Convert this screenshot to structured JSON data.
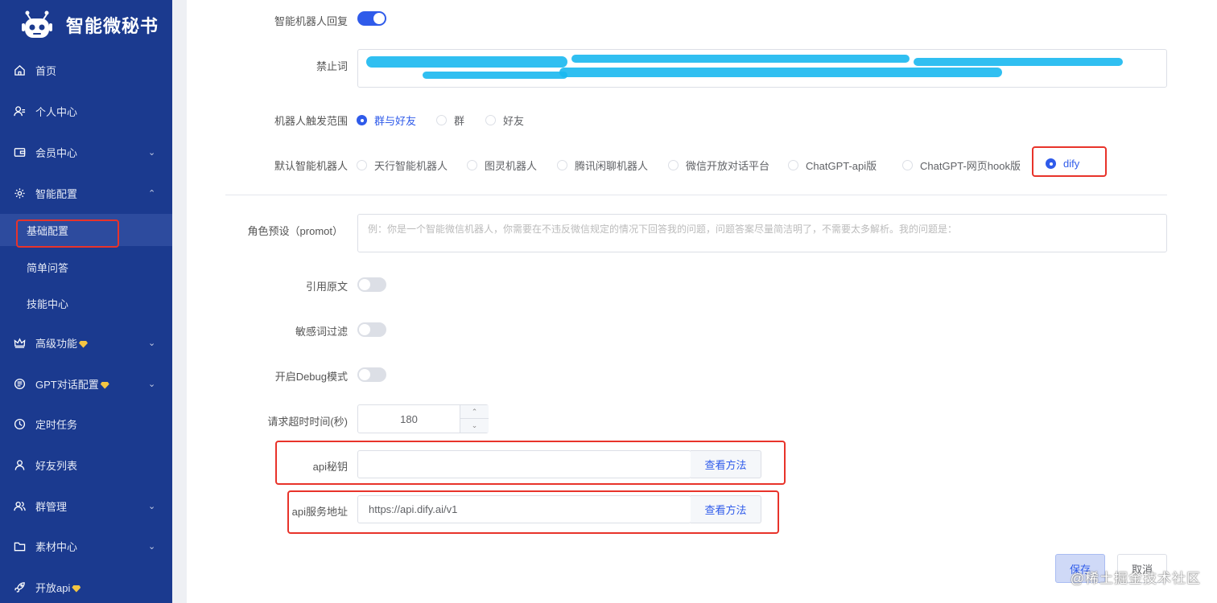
{
  "app": {
    "title": "智能微秘书"
  },
  "sidebar": {
    "items": [
      {
        "label": "首页"
      },
      {
        "label": "个人中心"
      },
      {
        "label": "会员中心"
      },
      {
        "label": "智能配置"
      },
      {
        "label": "高级功能"
      },
      {
        "label": "GPT对话配置"
      },
      {
        "label": "定时任务"
      },
      {
        "label": "好友列表"
      },
      {
        "label": "群管理"
      },
      {
        "label": "素材中心"
      },
      {
        "label": "开放api"
      }
    ],
    "sub_items": [
      {
        "label": "基础配置"
      },
      {
        "label": "简单问答"
      },
      {
        "label": "技能中心"
      }
    ]
  },
  "form": {
    "smart_reply": {
      "label": "智能机器人回复",
      "on": true
    },
    "banned_words": {
      "label": "禁止词"
    },
    "trigger_scope": {
      "label": "机器人触发范围",
      "options": [
        "群与好友",
        "群",
        "好友"
      ],
      "selected": "群与好友"
    },
    "default_bot": {
      "label": "默认智能机器人",
      "options": [
        "天行智能机器人",
        "图灵机器人",
        "腾讯闲聊机器人",
        "微信开放对话平台",
        "ChatGPT-api版",
        "ChatGPT-网页hook版",
        "dify"
      ],
      "selected": "dify"
    },
    "role_preset": {
      "label": "角色预设（promot）",
      "placeholder": "例：你是一个智能微信机器人，你需要在不违反微信规定的情况下回答我的问题，问题答案尽量简洁明了，不需要太多解析。我的问题是："
    },
    "quote_original": {
      "label": "引用原文",
      "on": false
    },
    "sensitive_filter": {
      "label": "敏感词过滤",
      "on": false
    },
    "debug_mode": {
      "label": "开启Debug模式",
      "on": false
    },
    "timeout": {
      "label": "请求超时时间(秒)",
      "value": "180"
    },
    "api_key": {
      "label": "api秘钥",
      "value": "",
      "button": "查看方法"
    },
    "api_url": {
      "label": "api服务地址",
      "value": "https://api.dify.ai/v1",
      "button": "查看方法"
    },
    "save_label": "保存",
    "cancel_label": "取消"
  },
  "watermark": "@稀土掘金技术社区",
  "colors": {
    "sidebar": "#1b3a8f",
    "accent": "#2f5bea",
    "highlight": "#e8332a"
  }
}
